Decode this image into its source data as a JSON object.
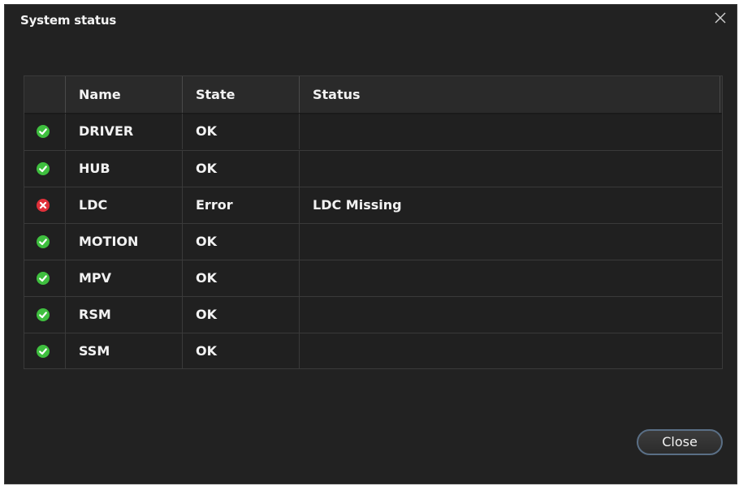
{
  "dialog": {
    "title": "System status",
    "close_button_label": "Close"
  },
  "table": {
    "columns": [
      "Name",
      "State",
      "Status"
    ],
    "rows": [
      {
        "name": "DRIVER",
        "state": "OK",
        "status": "",
        "icon": "check-circle-icon"
      },
      {
        "name": "HUB",
        "state": "OK",
        "status": "",
        "icon": "check-circle-icon"
      },
      {
        "name": "LDC",
        "state": "Error",
        "status": "LDC Missing",
        "icon": "error-circle-icon"
      },
      {
        "name": "MOTION",
        "state": "OK",
        "status": "",
        "icon": "check-circle-icon"
      },
      {
        "name": "MPV",
        "state": "OK",
        "status": "",
        "icon": "check-circle-icon"
      },
      {
        "name": "RSM",
        "state": "OK",
        "status": "",
        "icon": "check-circle-icon"
      },
      {
        "name": "SSM",
        "state": "OK",
        "status": "",
        "icon": "check-circle-icon"
      }
    ]
  },
  "colors": {
    "ok": "#3fbf3f",
    "error": "#e0303a",
    "button_border": "#5a6f86"
  }
}
